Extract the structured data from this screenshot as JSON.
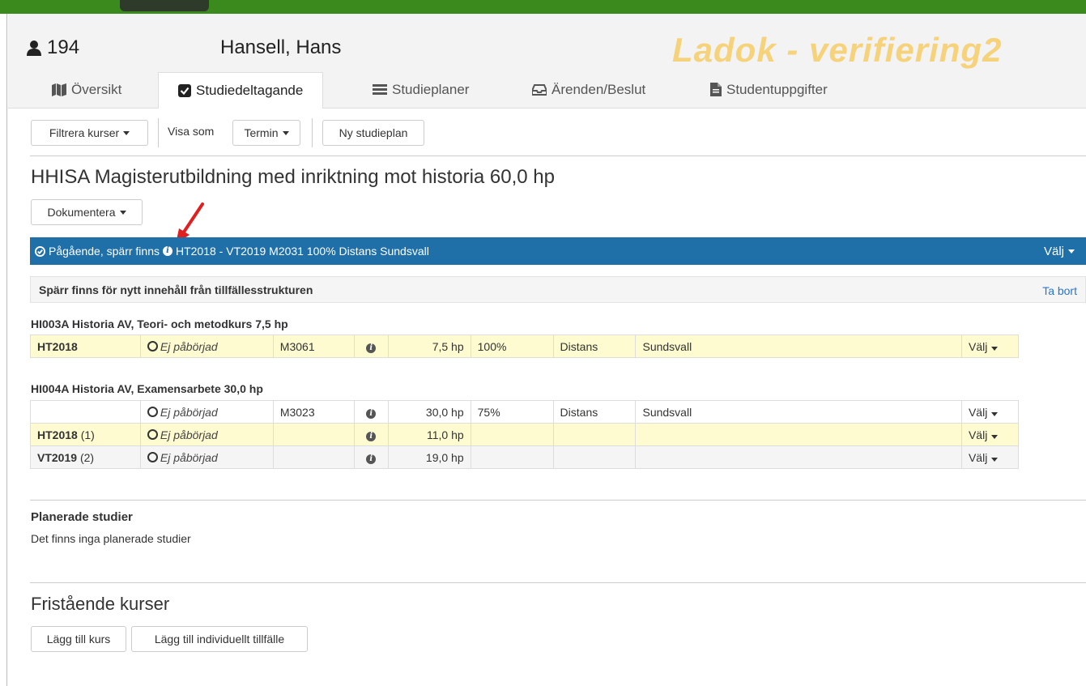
{
  "header": {
    "student_id": "194",
    "student_name": "Hansell, Hans",
    "environment": "Ladok - verifiering2"
  },
  "tabs": [
    {
      "label": "Översikt",
      "icon": "map-icon"
    },
    {
      "label": "Studiedeltagande",
      "icon": "checkbox-icon",
      "active": true
    },
    {
      "label": "Studieplaner",
      "icon": "list-icon"
    },
    {
      "label": "Ärenden/Beslut",
      "icon": "inbox-icon"
    },
    {
      "label": "Studentuppgifter",
      "icon": "document-icon"
    }
  ],
  "toolbar": {
    "filter_label": "Filtrera kurser",
    "show_as_label": "Visa som",
    "show_as_value": "Termin",
    "new_plan_label": "Ny studieplan"
  },
  "program": {
    "title": "HHISA Magisterutbildning med inriktning mot historia 60,0 hp",
    "document_label": "Dokumentera",
    "status_bar": {
      "status": "Pågående, spärr finns",
      "details": "HT2018 - VT2019 M2031 100% Distans Sundsvall",
      "valj": "Välj"
    },
    "block_bar": {
      "text": "Spärr finns för nytt innehåll från tillfällesstrukturen",
      "remove_label": "Ta bort"
    }
  },
  "courses": [
    {
      "title": "HI003A Historia AV, Teori- och metodkurs 7,5 hp",
      "rows": [
        {
          "term": "HT2018",
          "part": "",
          "status": "Ej påbörjad",
          "code": "M3061",
          "hp": "7,5 hp",
          "pct": "100%",
          "form": "Distans",
          "place": "Sundsvall",
          "valj": "Välj",
          "style": "yellow"
        }
      ]
    },
    {
      "title": "HI004A Historia AV, Examensarbete 30,0 hp",
      "rows": [
        {
          "term": "",
          "part": "",
          "status": "Ej påbörjad",
          "code": "M3023",
          "hp": "30,0 hp",
          "pct": "75%",
          "form": "Distans",
          "place": "Sundsvall",
          "valj": "Välj",
          "style": "white"
        },
        {
          "term": "HT2018",
          "part": "(1)",
          "status": "Ej påbörjad",
          "code": "",
          "hp": "11,0 hp",
          "pct": "",
          "form": "",
          "place": "",
          "valj": "Välj",
          "style": "yellow"
        },
        {
          "term": "VT2019",
          "part": "(2)",
          "status": "Ej påbörjad",
          "code": "",
          "hp": "19,0 hp",
          "pct": "",
          "form": "",
          "place": "",
          "valj": "Välj",
          "style": "grey"
        }
      ]
    }
  ],
  "planned": {
    "heading": "Planerade studier",
    "text": "Det finns inga planerade studier"
  },
  "standalone": {
    "heading": "Fristående kurser",
    "add_course_label": "Lägg till kurs",
    "add_individual_label": "Lägg till individuellt tillfälle"
  },
  "colors": {
    "top_bar": "#3a8a1e",
    "status_bar": "#1f6fa8",
    "highlight_row": "#fdfbcf",
    "environment_text": "#f6d27a",
    "annotation_arrow": "#e02020"
  }
}
